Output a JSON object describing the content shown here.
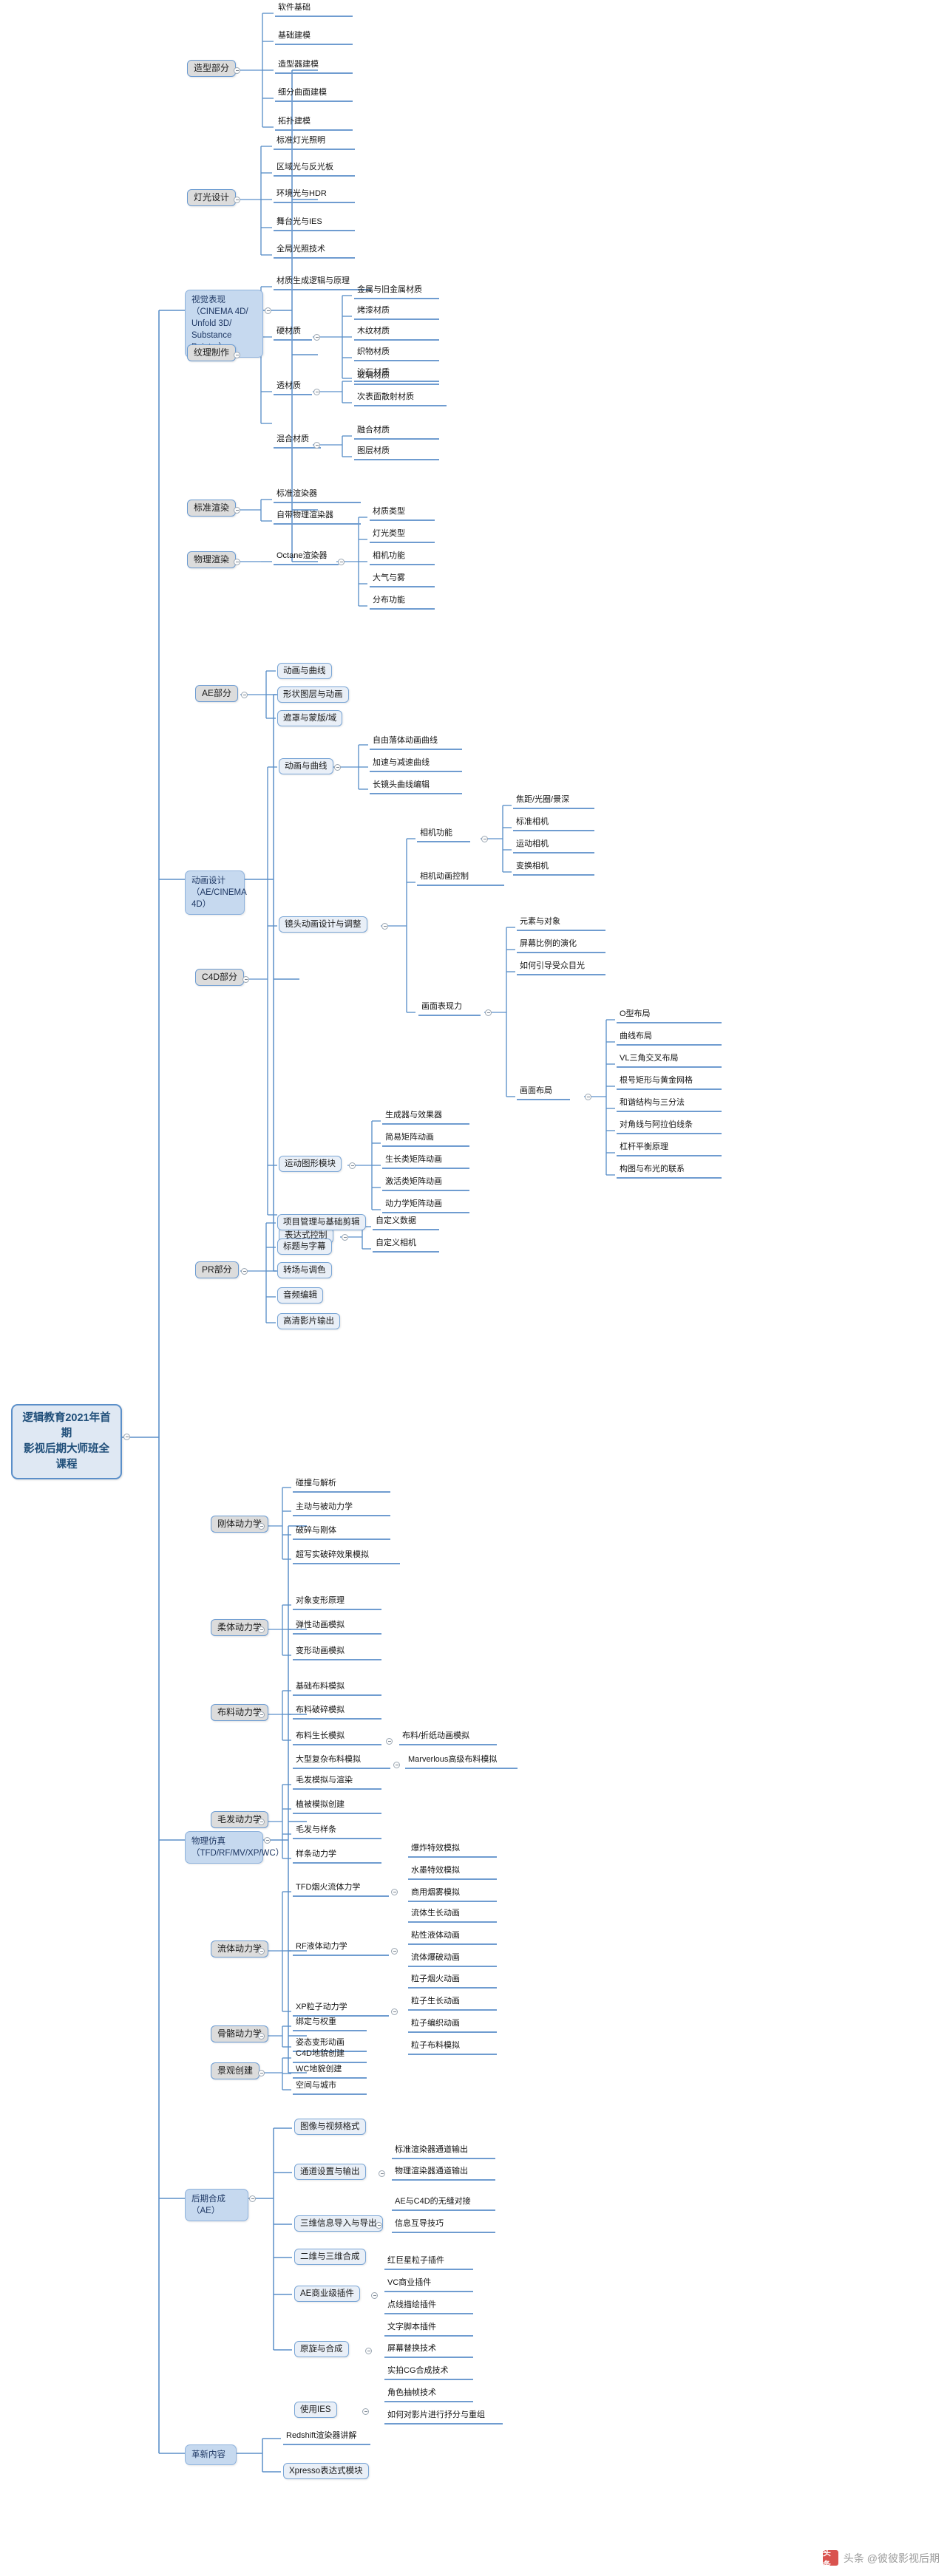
{
  "meta": {
    "root_title_line1": "逻辑教育2021年首期",
    "root_title_line2": "影视后期大师班全课程",
    "accent": "#6f9cd0",
    "root_fill": "#dfe8f3",
    "root_border": "#5b8fc9",
    "branch_fill": "#c6d9ef",
    "node_fill": "#dcdcdc"
  },
  "watermark": {
    "logo": "头条",
    "text": "头条 @彼彼影视后期"
  },
  "branches": {
    "b1": {
      "label": "视觉表现（CINEMA 4D/ Unfold 3D/ Substance Painter）"
    },
    "b2": {
      "label": "动画设计（AE/CINEMA 4D）"
    },
    "b3": {
      "label": "物理仿真（TFD/RF/MV/XP/WC）"
    },
    "b4": {
      "label": "后期合成（AE）"
    },
    "b5": {
      "label": "革新内容"
    }
  },
  "groups": {
    "g_xingti": "造型部分",
    "g_dengguang": "灯光设计",
    "g_wenli": "纹理制作",
    "g_biaozhunxuanran": "标准渲染",
    "g_wulixuanran": "物理渲染",
    "g_ae": "AE部分",
    "g_c4d": "C4D部分",
    "g_pr": "PR部分",
    "g_gangti": "刚体动力学",
    "g_routi": "柔体动力学",
    "g_buliao": "布料动力学",
    "g_maofa": "毛发动力学",
    "g_liuti": "流体动力学",
    "g_gugge": "骨骼动力学",
    "g_jingguan": "景观创建"
  },
  "items": {
    "t_ruanjianjichu": "软件基础",
    "t_jichujianmo": "基础建模",
    "t_zaoxingqi": "造型器建模",
    "t_xifenqumian": "细分曲面建模",
    "t_tuopu": "拓扑建模",
    "t_biaozhundengguang": "标准灯光照明",
    "t_quyuguang": "区域光与反光板",
    "t_huanjingguang": "环境光与HDR",
    "t_wutaiguang": "舞台光与IES",
    "t_quanjuguang": "全局光照技术",
    "t_caizhiluoji": "材质生成逻辑与原理",
    "t_yingcaizhi": "硬材质",
    "t_jinshu": "金属与旧金属材质",
    "t_kaoqi": "烤漆材质",
    "t_muwen": "木纹材质",
    "t_zhiwu": "织物材质",
    "t_shashi": "沙石材质",
    "t_toucaizhi": "透材质",
    "t_boli": "玻璃材质",
    "t_cibiaomian": "次表面散射材质",
    "t_hunhecaizhi": "混合材质",
    "t_ronghe": "融合材质",
    "t_tuceng": "图层材质",
    "t_biaozhunxuanranqi": "标准渲染器",
    "t_zidaiwuli": "自带物理渲染器",
    "t_octane": "Octane渲染器",
    "t_caizhileixing": "材质类型",
    "t_dengguangleixing": "灯光类型",
    "t_xiangjigongneng_o": "相机功能",
    "t_daqiyuwu": "大气与雾",
    "t_fenbugongneng": "分布功能",
    "t_donghuaquxian_ae": "动画与曲线",
    "t_xingzhuangtuceng": "形状图层与动画",
    "t_zhezhaomengban": "遮罩与蒙版/域",
    "t_donghuaquxian_c4d": "动画与曲线",
    "t_ziyouluoti": "自由落体动画曲线",
    "t_jiasujiansu": "加速与减速曲线",
    "t_changjingtou": "长镜头曲线编辑",
    "t_jingtoudonghua": "镜头动画设计与调整",
    "t_xiangjigongneng": "相机功能",
    "t_jiaoju": "焦距/光圈/景深",
    "t_biaozhunxiangji": "标准相机",
    "t_yundongxiangji": "运动相机",
    "t_bianhuanxiangji": "变换相机",
    "t_xiangjidonghuakongzhi": "相机动画控制",
    "t_huamianbiaoxianli": "画面表现力",
    "t_yuansuduixiang": "元素与对象",
    "t_pingmubili": "屏幕比例的演化",
    "t_ruheyindao": "如何引导受众目光",
    "t_huamianbuju": "画面布局",
    "t_obuju": "O型布局",
    "t_quxianbuju": "曲线布局",
    "t_vlsanjiao": "VL三角交叉布局",
    "t_genhao": "根号矩形与黄金网格",
    "t_hexie": "和谐结构与三分法",
    "t_duijiaoxian": "对角线与阿拉伯线条",
    "t_gangganpingheng": "杠杆平衡原理",
    "t_goutubuguang": "构图与布光的联系",
    "t_yundongtuxing": "运动图形模块",
    "t_shengchengqi": "生成器与效果器",
    "t_jianyijuzhen": "简易矩阵动画",
    "t_shengzhangjuzhen": "生长类矩阵动画",
    "t_jihuojuzhen": "激活类矩阵动画",
    "t_donglixuejuzhen": "动力学矩阵动画",
    "t_biaodashi": "表达式控制",
    "t_zidingyishuju": "自定义数据",
    "t_zidingyixiangji": "自定义相机",
    "t_xiangmuguanli": "项目管理与基础剪辑",
    "t_biaotizimu": "标题与字幕",
    "t_zhuanchangtiaose": "转场与调色",
    "t_yinpinbianji": "音频编辑",
    "t_gaoqingshupian": "高清影片输出",
    "t_pengzhuangjiexi": "碰撞与解析",
    "t_zhudongbeidong": "主动与被动力学",
    "t_posuigangti": "破碎与刚体",
    "t_chaoxieshi": "超写实破碎效果模拟",
    "t_duixiangbianxing": "对象变形原理",
    "t_tanxingdonghua": "弹性动画模拟",
    "t_bianxingdonghua": "变形动画模拟",
    "t_jichubuliao": "基础布料模拟",
    "t_buliaoposui": "布料破碎模拟",
    "t_buliaoshengzhang": "布料生长模拟",
    "t_buliaozhezhi": "布料/折纸动画模拟",
    "t_daxingfuza": "大型复杂布料模拟",
    "t_marverlous": "Marverlous高级布料模拟",
    "t_maofamoni": "毛发模拟与渲染",
    "t_zhibeimoni": "植被模拟创建",
    "t_maofayangtiao": "毛发与样条",
    "t_yangtiaodonglixue": "样条动力学",
    "t_tfd": "TFD烟火流体力学",
    "t_baozha": "爆炸特效模拟",
    "t_shuimo": "水墨特效模拟",
    "t_shangyongyanwu": "商用烟雾模拟",
    "t_rf": "RF液体动力学",
    "t_liutishengzhang": "流体生长动画",
    "t_zhanxingyeti": "粘性液体动画",
    "t_liutibaopo": "流体爆破动画",
    "t_xp": "XP粒子动力学",
    "t_lizhiyanhuo": "粒子烟火动画",
    "t_lizishengzhang": "粒子生长动画",
    "t_lizibianzhi": "粒子编织动画",
    "t_liziliuti": "粒子布料模拟",
    "t_bangdingquanzhong": "绑定与权重",
    "t_zitaibianxing": "姿态变形动画",
    "t_c4ddimao": "C4D地貌创建",
    "t_wcdimao": "WC地貌创建",
    "t_kongjianchengshi": "空间与城市",
    "t_tuxiangshipin": "图像与视频格式",
    "t_tongdaoshezhi": "通道设置与输出",
    "t_biaozhuntongdao": "标准渲染器通道输出",
    "t_wulitongdao": "物理渲染器通道输出",
    "t_sanweixinxi": "三维信息导入与导出",
    "t_aec4d": "AE与C4D的无缝对接",
    "t_xinxihudao": "信息互导技巧",
    "t_erweisanwei": "二维与三维合成",
    "t_aeshangye": "AE商业级插件",
    "t_hongjuxing": "红巨星粒子插件",
    "t_vcshangye": "VC商业插件",
    "t_dianzhuimiaobian": "点线描绘插件",
    "t_wenzijiaoben": "文字脚本插件",
    "t_yuanxian": "原旋与合成",
    "t_pingmutisheng": "屏幕替换技术",
    "t_shipaicg": "实拍CG合成技术",
    "t_juesechouzhen": "角色抽帧技术",
    "t_shiyongies": "使用IES",
    "t_ruheduikan": "如何对影片进行抒分与重组",
    "t_redshift": "Redshift渲染器讲解",
    "t_xpresso": "Xpresso表达式模块"
  }
}
